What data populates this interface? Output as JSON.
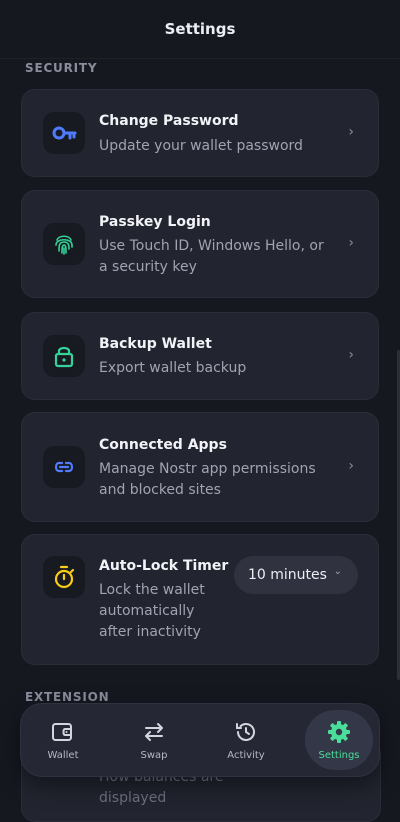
{
  "header": {
    "title": "Settings"
  },
  "sections": {
    "security": "SECURITY",
    "extension": "EXTENSION"
  },
  "security_items": [
    {
      "title": "Change Password",
      "description": "Update your wallet password",
      "icon": "key-icon",
      "icon_color": "#4f7cff"
    },
    {
      "title": "Passkey Login",
      "description": "Use Touch ID, Windows Hello, or a security key",
      "icon": "fingerprint-icon",
      "icon_color": "#34d399"
    },
    {
      "title": "Backup Wallet",
      "description": "Export wallet backup",
      "icon": "lock-icon",
      "icon_color": "#34d399"
    },
    {
      "title": "Connected Apps",
      "description": "Manage Nostr app permissions and blocked sites",
      "icon": "link-icon",
      "icon_color": "#4f7cff"
    },
    {
      "title": "Auto-Lock Timer",
      "description": "Lock the wallet automatically after inactivity",
      "icon": "timer-icon",
      "icon_color": "#facc15",
      "selected_value": "10 minutes"
    }
  ],
  "partial_item": {
    "description": "How balances are displayed"
  },
  "nav": {
    "items": [
      {
        "label": "Wallet",
        "icon": "wallet-icon"
      },
      {
        "label": "Swap",
        "icon": "swap-icon"
      },
      {
        "label": "Activity",
        "icon": "history-icon"
      },
      {
        "label": "Settings",
        "icon": "gear-icon"
      }
    ],
    "active": "Settings",
    "accent": "#4ade9a"
  }
}
